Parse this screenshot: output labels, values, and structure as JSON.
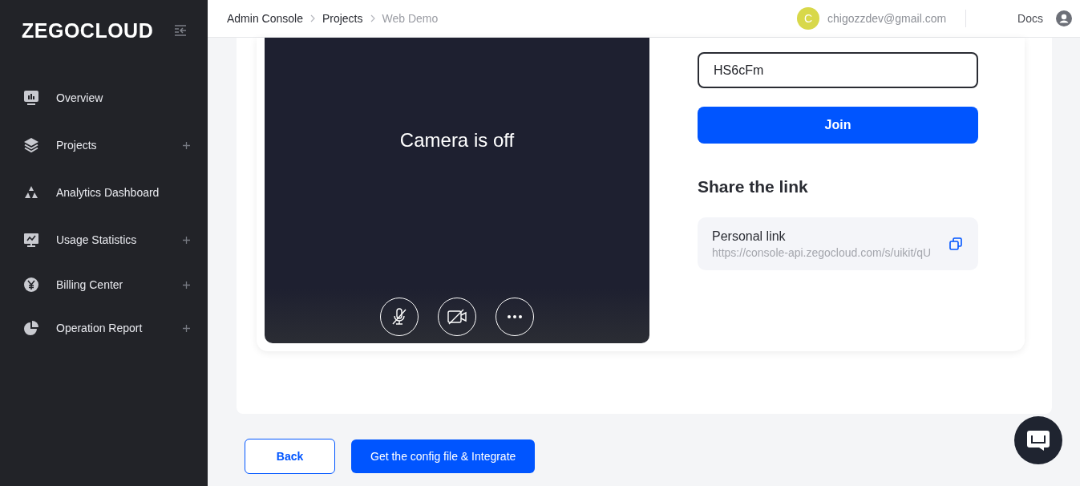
{
  "sidebar": {
    "logo": "ZEGOCLOUD",
    "items": [
      {
        "label": "Overview",
        "expandable": false
      },
      {
        "label": "Projects",
        "expandable": true
      },
      {
        "label": "Analytics Dashboard",
        "expandable": false
      },
      {
        "label": "Usage Statistics",
        "expandable": true
      },
      {
        "label": "Billing Center",
        "expandable": true
      },
      {
        "label": "Operation Report",
        "expandable": true
      }
    ]
  },
  "topbar": {
    "breadcrumbs": [
      {
        "label": "Admin Console",
        "current": false
      },
      {
        "label": "Projects",
        "current": false
      },
      {
        "label": "Web Demo",
        "current": true
      }
    ],
    "avatar": "C",
    "email": "chigozzdev@gmail.com",
    "docs": "Docs"
  },
  "preview": {
    "message": "Camera is off",
    "controls": [
      {
        "kind": "mic"
      },
      {
        "kind": "camera"
      },
      {
        "kind": "more"
      }
    ]
  },
  "join": {
    "value": "HS6cFm",
    "button": "Join"
  },
  "share": {
    "title": "Share the link",
    "link_label": "Personal link",
    "link_url": "https://console-api.zegocloud.com/s/uikit/qU"
  },
  "footer": {
    "back": "Back",
    "primary": "Get the config file & Integrate"
  }
}
